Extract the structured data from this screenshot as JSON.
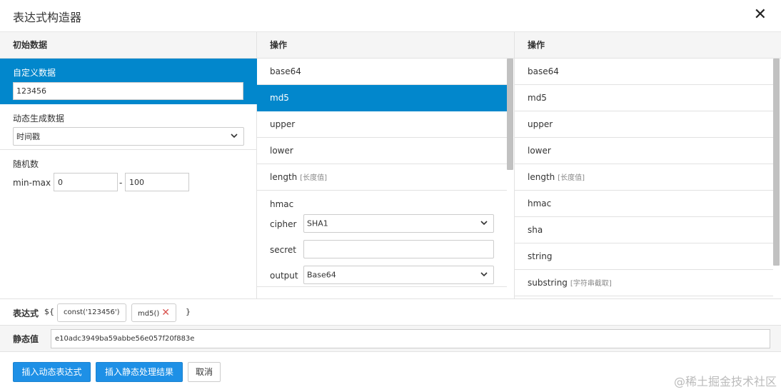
{
  "dialog": {
    "title": "表达式构造器",
    "close_icon": "close-icon"
  },
  "columns": {
    "source_header": "初始数据",
    "ops_header": "操作",
    "ops2_header": "操作"
  },
  "source": {
    "custom_label": "自定义数据",
    "custom_value": "123456",
    "dynamic_label": "动态生成数据",
    "dynamic_selected": "时间戳",
    "random_label": "随机数",
    "minmax_label": "min-max",
    "min_value": "0",
    "range_sep": "-",
    "max_value": "100"
  },
  "ops_left": {
    "items": [
      {
        "label": "base64",
        "hint": ""
      },
      {
        "label": "md5",
        "hint": ""
      },
      {
        "label": "upper",
        "hint": ""
      },
      {
        "label": "lower",
        "hint": ""
      },
      {
        "label": "length",
        "hint": "[长度值]"
      }
    ],
    "active_index": 1,
    "hmac": {
      "label": "hmac",
      "cipher_label": "cipher",
      "cipher_value": "SHA1",
      "secret_label": "secret",
      "secret_value": "",
      "output_label": "output",
      "output_value": "Base64"
    }
  },
  "ops_right": {
    "items": [
      {
        "label": "base64",
        "hint": ""
      },
      {
        "label": "md5",
        "hint": ""
      },
      {
        "label": "upper",
        "hint": ""
      },
      {
        "label": "lower",
        "hint": ""
      },
      {
        "label": "length",
        "hint": "[长度值]"
      },
      {
        "label": "hmac",
        "hint": ""
      },
      {
        "label": "sha",
        "hint": ""
      },
      {
        "label": "string",
        "hint": ""
      },
      {
        "label": "substring",
        "hint": "[字符串截取]"
      }
    ]
  },
  "expression": {
    "label": "表达式",
    "open": "${",
    "chips": [
      "const('123456')",
      "md5()"
    ],
    "close": "}"
  },
  "static_value": {
    "label": "静态值",
    "value": "e10adc3949ba59abbe56e057f20f883e"
  },
  "footer": {
    "insert_dynamic": "插入动态表达式",
    "insert_static": "插入静态处理结果",
    "cancel": "取消",
    "watermark": "@稀土掘金技术社区"
  },
  "colors": {
    "accent": "#0287cc",
    "button": "#1e90e6",
    "remove": "#d9534f"
  }
}
